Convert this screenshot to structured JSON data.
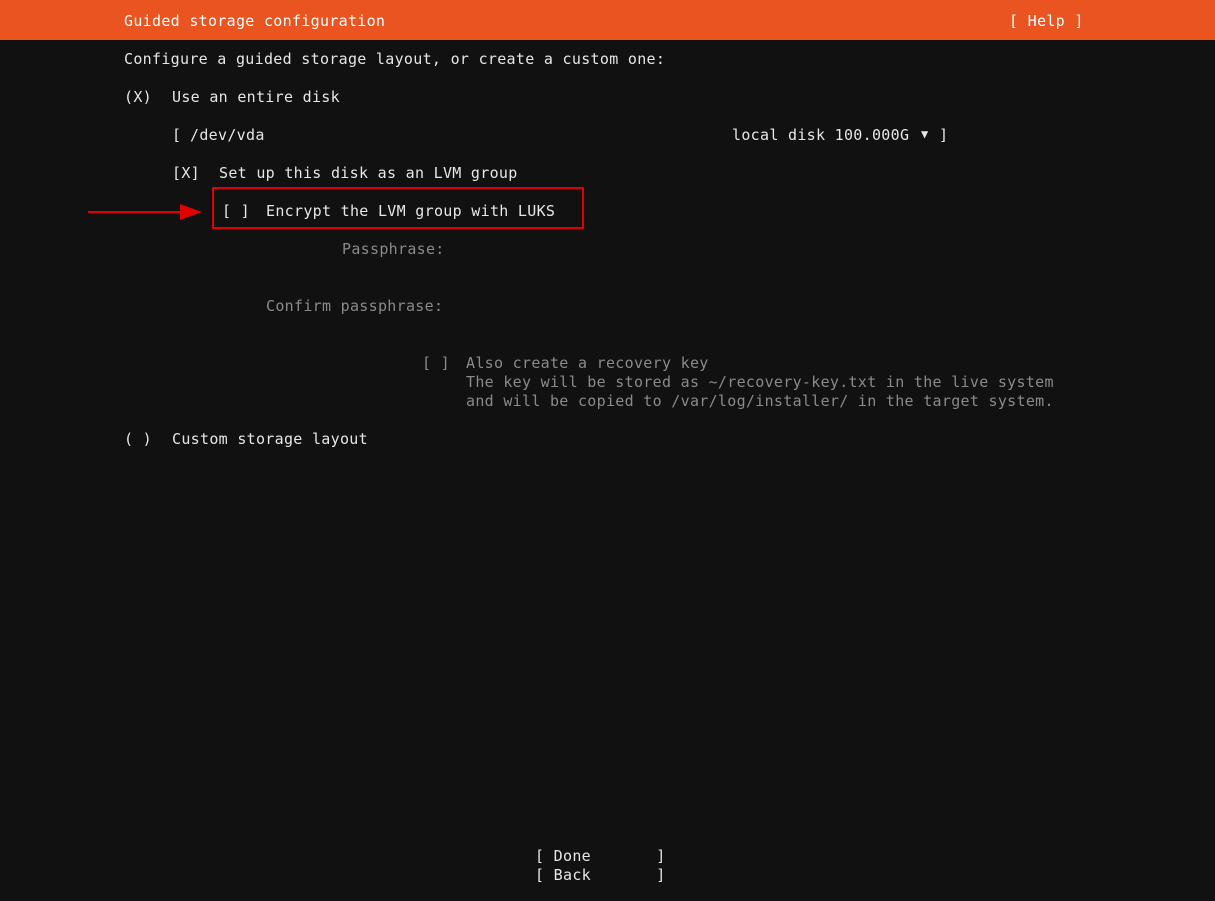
{
  "header": {
    "title": "Guided storage configuration",
    "help_label": "[ Help ]"
  },
  "intro": "Configure a guided storage layout, or create a custom one:",
  "entire_disk": {
    "radio": "(X)",
    "label": "Use an entire disk"
  },
  "disk_select": {
    "open_bracket": "[",
    "value": "/dev/vda",
    "detail": "local disk 100.000G",
    "arrow": "▼",
    "close_bracket": "]"
  },
  "lvm": {
    "checkbox": "[X]",
    "label": "Set up this disk as an LVM group"
  },
  "luks": {
    "checkbox": "[ ]",
    "label": "Encrypt the LVM group with LUKS"
  },
  "passphrase": {
    "label": "Passphrase:"
  },
  "confirm_passphrase": {
    "label": "Confirm passphrase:"
  },
  "recovery_key": {
    "checkbox": "[ ]",
    "label": "Also create a recovery key",
    "desc_line1": "The key will be stored as ~/recovery-key.txt in the live system",
    "desc_line2": "and will be copied to /var/log/installer/ in the target system."
  },
  "custom_layout": {
    "radio": "( )",
    "label": "Custom storage layout"
  },
  "buttons": {
    "done": "[ Done       ]",
    "back": "[ Back       ]"
  },
  "colors": {
    "header_bg": "#e95420",
    "background": "#111111",
    "highlight": "#e00000"
  }
}
